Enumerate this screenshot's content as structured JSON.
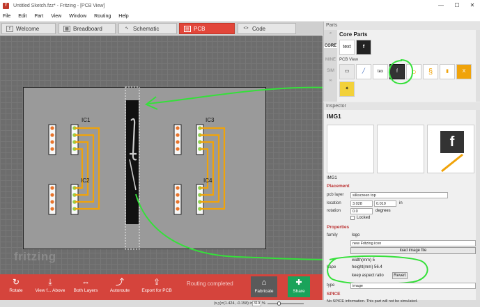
{
  "window": {
    "title": "Untitled Sketch.fzz* - Fritzing - [PCB View]",
    "minimize": "—",
    "maximize": "☐",
    "close": "✕"
  },
  "menu": [
    "File",
    "Edit",
    "Part",
    "View",
    "Window",
    "Routing",
    "Help"
  ],
  "tabs": [
    {
      "label": "Welcome",
      "icon": "f",
      "active": false
    },
    {
      "label": "Breadboard",
      "icon": "▦",
      "active": false
    },
    {
      "label": "Schematic",
      "icon": "∿",
      "active": false
    },
    {
      "label": "PCB",
      "icon": "▤",
      "active": true
    },
    {
      "label": "Code",
      "icon": "<>",
      "active": false
    }
  ],
  "canvas": {
    "watermark": "fritzing",
    "ic_labels": [
      "IC1",
      "IC2",
      "IC3",
      "IC4"
    ],
    "colors": {
      "board": "#9a9a9a",
      "trace": "#f0a30a",
      "pad_green": "#8fd14f",
      "pad_orange": "#e8742b",
      "annotation": "#35e03a"
    }
  },
  "toolbar": {
    "rotate": "Rotate",
    "view_from_above": "View f... Above",
    "both_layers": "Both Layers",
    "autoroute": "Autoroute",
    "export": "Export for PCB",
    "status": "Routing completed",
    "fabricate": "Fabricate",
    "share": "Share"
  },
  "statusbar": {
    "coords": "(x,y)=(1.424, -0.158) in",
    "zoom": "319",
    "zoom_unit": "%"
  },
  "parts": {
    "header": "Parts",
    "bin_tabs": [
      "CORE",
      "MINE",
      "SIM"
    ],
    "core_title": "Core Parts",
    "pcb_view_label": "PCB View",
    "text_tile": "text",
    "text_tile_small": "tex"
  },
  "inspector": {
    "header": "Inspector",
    "title": "IMG1",
    "caption": "IMG1",
    "placement_label": "Placement",
    "pcb_layer_label": "pcb layer",
    "pcb_layer_value": "silkscreen top",
    "location_label": "location",
    "location_x": "3.028",
    "location_y": "0.010",
    "location_unit": "in",
    "rotation_label": "rotation",
    "rotation_value": "0.0",
    "rotation_unit": "degrees",
    "locked_label": "Locked",
    "properties_label": "Properties",
    "family_label": "family",
    "family_value": "logo",
    "icon_select": "new Fritzing icon",
    "load_image": "load image file",
    "shape_label": "hape",
    "width_label": "width(mm) 5",
    "height_label": "height(mm) 56.4",
    "keep_aspect": "keep aspect ratio",
    "revert": "Revert",
    "type_label": "type",
    "type_value": "image",
    "spice_label": "SPICE",
    "spice_note": "No SPICE information. This part will not be simulated."
  }
}
